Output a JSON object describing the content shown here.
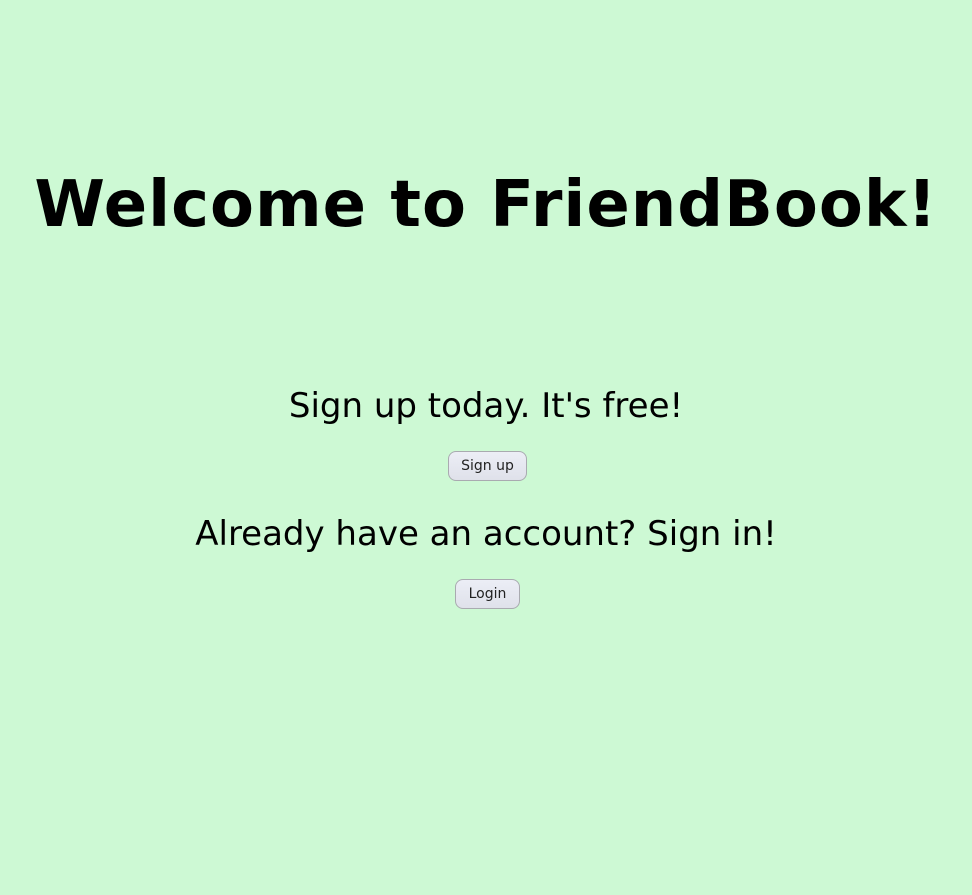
{
  "page": {
    "title": "Welcome to FriendBook!",
    "background_color": "#cdf9d4"
  },
  "signup": {
    "prompt": "Sign up today. It's free!",
    "button_label": "Sign up"
  },
  "login": {
    "prompt": "Already have an account? Sign in!",
    "button_label": "Login"
  }
}
